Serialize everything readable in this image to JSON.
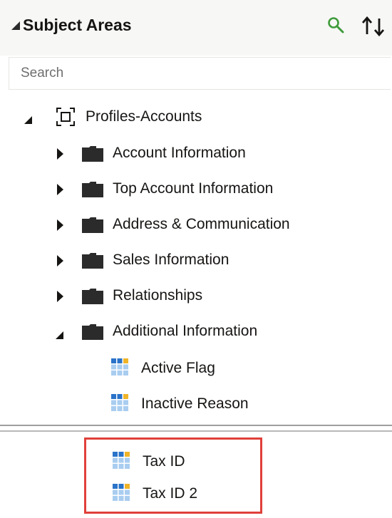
{
  "panel": {
    "title": "Subject Areas"
  },
  "search": {
    "placeholder": "Search",
    "value": ""
  },
  "tree": {
    "subject_area": {
      "label": "Profiles-Accounts",
      "expanded": true
    },
    "folders": [
      {
        "label": "Account Information",
        "expanded": false
      },
      {
        "label": "Top Account Information",
        "expanded": false
      },
      {
        "label": "Address & Communication",
        "expanded": false
      },
      {
        "label": "Sales Information",
        "expanded": false
      },
      {
        "label": "Relationships",
        "expanded": false
      },
      {
        "label": "Additional Information",
        "expanded": true
      }
    ],
    "columns": [
      {
        "label": "Active Flag"
      },
      {
        "label": "Inactive Reason"
      }
    ]
  },
  "highlighted_columns": [
    {
      "label": "Tax ID"
    },
    {
      "label": "Tax ID 2"
    }
  ],
  "colors": {
    "search_icon": "#3f9b3a",
    "highlight_border": "#e0403a",
    "column_icon_blue": "#2a73c9",
    "column_icon_light": "#a9cdf0"
  },
  "icons": {
    "header_search": "search-icon",
    "header_sort": "sort-icon",
    "subject_area": "subject-area-icon",
    "folder": "folder-icon",
    "column": "column-icon"
  }
}
